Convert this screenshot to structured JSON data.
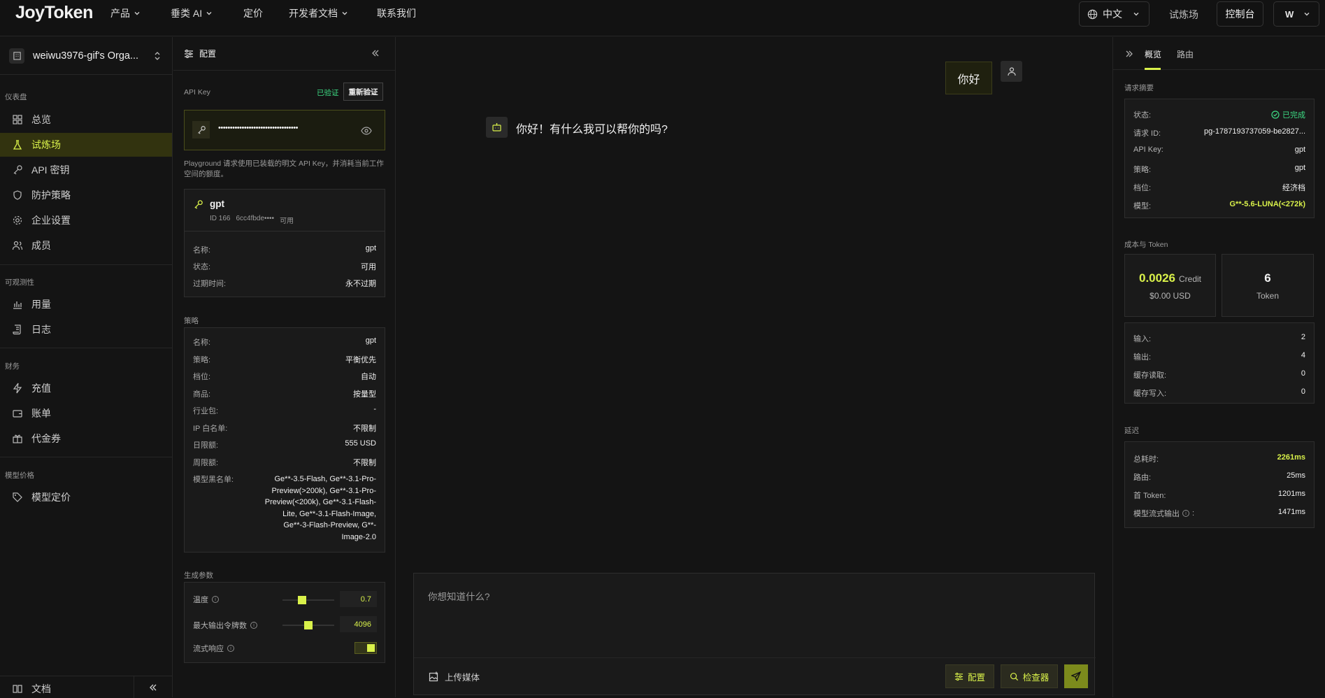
{
  "topbar": {
    "logo": "JoyToken",
    "nav": [
      "产品",
      "垂类 AI",
      "定价",
      "开发者文档",
      "联系我们"
    ],
    "lang": "中文",
    "playground_link": "试炼场",
    "console": "控制台",
    "user_initial": "W"
  },
  "sidebar": {
    "org_name": "weiwu3976-gif's Orga...",
    "sections": [
      "仪表盘",
      "可观测性",
      "财务",
      "模型价格"
    ],
    "items": [
      "总览",
      "试炼场",
      "API 密钥",
      "防护策略",
      "企业设置",
      "成员",
      "用量",
      "日志",
      "充值",
      "账单",
      "代金券",
      "模型定价"
    ],
    "footer_doc": "文档"
  },
  "config": {
    "title": "配置",
    "api_key_label": "API Key",
    "verified": "已验证",
    "reverify": "重新验证",
    "api_key_value": "••••••••••••••••••••••••••••••••••",
    "hint": "Playground 请求使用已装载的明文 API Key，并消耗当前工作空间的额度。",
    "key_card": {
      "name": "gpt",
      "id": "ID 166",
      "prefix": "6cc4fbde••••",
      "avail": "可用",
      "rows": [
        [
          "名称:",
          "gpt"
        ],
        [
          "状态:",
          "可用"
        ],
        [
          "过期时间:",
          "永不过期"
        ]
      ]
    },
    "policy_label": "策略",
    "policy_rows": [
      [
        "名称:",
        "gpt"
      ],
      [
        "策略:",
        "平衡优先"
      ],
      [
        "档位:",
        "自动"
      ],
      [
        "商品:",
        "按量型"
      ],
      [
        "行业包:",
        "-"
      ],
      [
        "IP 白名单:",
        "不限制"
      ],
      [
        "日限额:",
        "555 USD"
      ],
      [
        "周限额:",
        "不限制"
      ]
    ],
    "blacklist_label": "模型黑名单:",
    "blacklist_lines": [
      "Ge**-3.5-Flash, Ge**-3.1-Pro-",
      "Preview(>200k), Ge**-3.1-Pro-",
      "Preview(<200k), Ge**-3.1-Flash-",
      "Lite, Ge**-3.1-Flash-Image,",
      "Ge**-3-Flash-Preview, G**-",
      "Image-2.0"
    ],
    "gen_label": "生成参数",
    "temperature_label": "温度",
    "temperature": "0.7",
    "temperature_fraction": 0.35,
    "max_tokens_label": "最大输出令牌数",
    "max_tokens": "4096",
    "max_tokens_fraction": 0.5,
    "stream_label": "流式响应",
    "stream_on": true
  },
  "chat": {
    "user_msg": "你好",
    "bot_msg": "你好！有什么我可以帮你的吗?",
    "placeholder": "你想知道什么?",
    "upload": "上传媒体",
    "config_btn": "配置",
    "inspector_btn": "检查器"
  },
  "inspector": {
    "tabs": [
      "概览",
      "路由"
    ],
    "summary_label": "请求摘要",
    "summary": [
      [
        "状态:",
        "已完成"
      ],
      [
        "请求 ID:",
        "pg-1787193737059-be2827..."
      ],
      [
        "API Key:",
        "gpt"
      ],
      [
        "策略:",
        "gpt"
      ],
      [
        "档位:",
        "经济档"
      ],
      [
        "模型:",
        "G**-5.6-LUNA(<272k)"
      ]
    ],
    "cost_label": "成本与 Token",
    "credit": "0.0026",
    "credit_unit": "Credit",
    "usd": "$0.00 USD",
    "tokens": "6",
    "tokens_unit": "Token",
    "token_rows": [
      [
        "输入:",
        "2"
      ],
      [
        "输出:",
        "4"
      ],
      [
        "缓存读取:",
        "0"
      ],
      [
        "缓存写入:",
        "0"
      ]
    ],
    "latency_label": "延迟",
    "latency": [
      [
        "总耗时:",
        "2261ms"
      ],
      [
        "路由:",
        "25ms"
      ],
      [
        "首 Token:",
        "1201ms"
      ],
      [
        "模型流式输出",
        "1471ms"
      ]
    ],
    "colors": {
      "accent": "#d9f14a",
      "success": "#3ddc84"
    }
  }
}
